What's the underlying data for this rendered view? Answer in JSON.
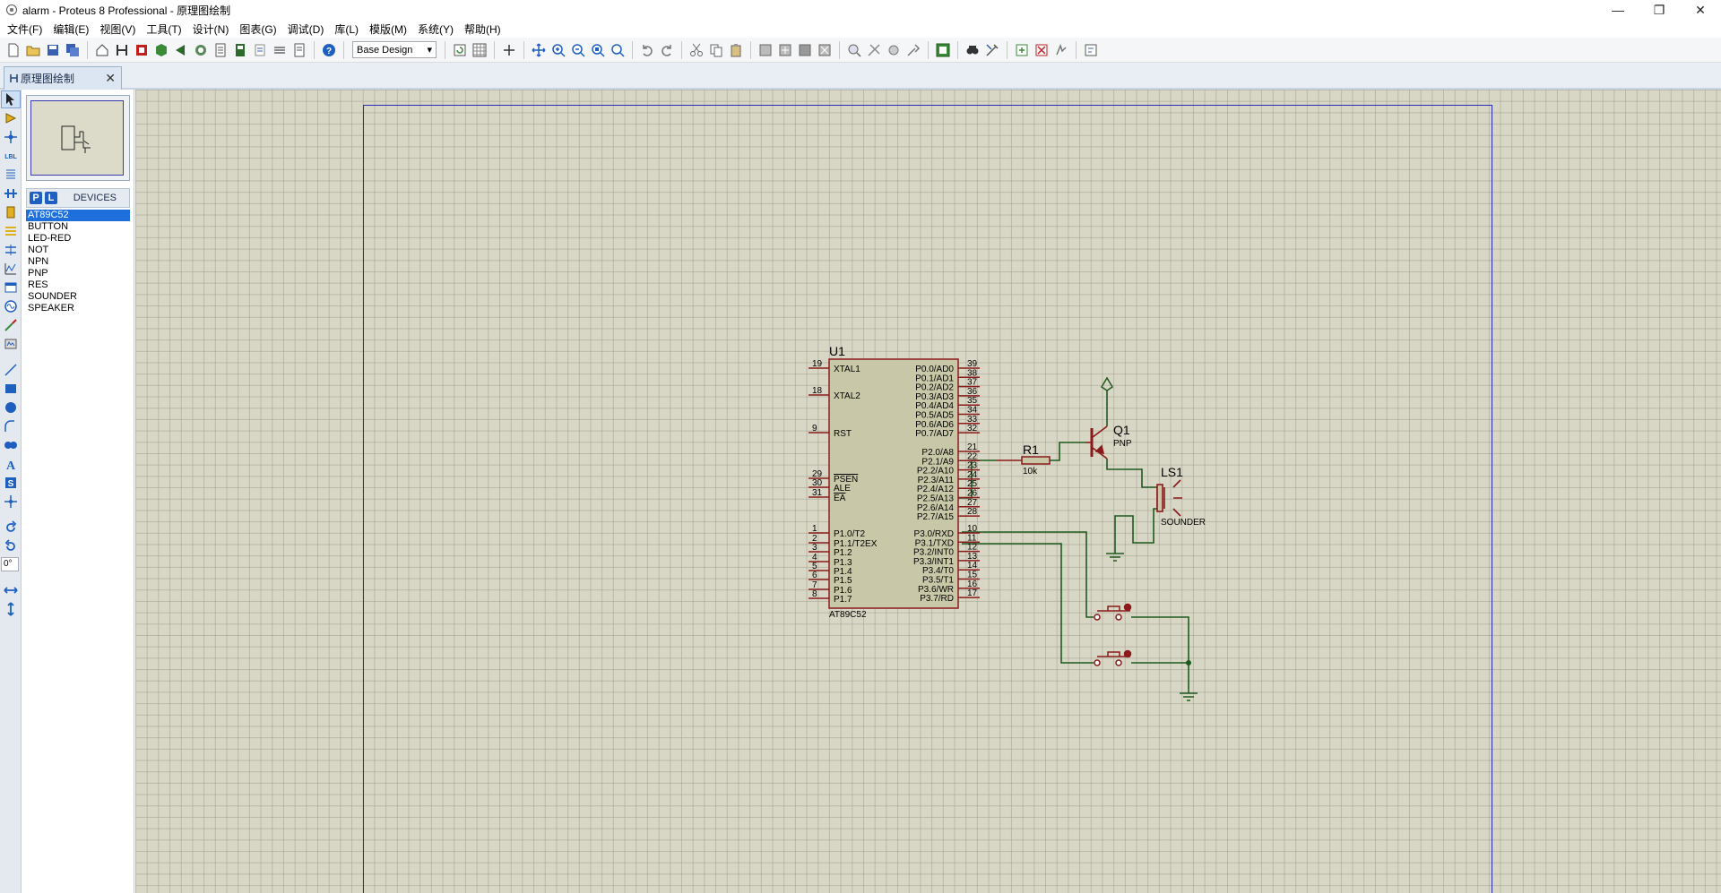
{
  "window": {
    "title": "alarm - Proteus 8 Professional - 原理图绘制",
    "minimize": "—",
    "maximize": "❐",
    "close": "✕"
  },
  "menu": [
    "文件(F)",
    "编辑(E)",
    "视图(V)",
    "工具(T)",
    "设计(N)",
    "图表(G)",
    "调试(D)",
    "库(L)",
    "模版(M)",
    "系统(Y)",
    "帮助(H)"
  ],
  "toolbar": {
    "design_select": "Base Design"
  },
  "tab": {
    "label": "原理图绘制",
    "close": "✕"
  },
  "toolcol": {
    "rotation": "0°"
  },
  "devices": {
    "p_label": "P",
    "l_label": "L",
    "title": "DEVICES",
    "items": [
      "AT89C52",
      "BUTTON",
      "LED-RED",
      "NOT",
      "NPN",
      "PNP",
      "RES",
      "SOUNDER",
      "SPEAKER"
    ],
    "selected": "AT89C52"
  },
  "schematic": {
    "u1": {
      "ref": "U1",
      "part": "AT89C52",
      "left_pins": [
        {
          "num": "19",
          "name": "XTAL1"
        },
        {
          "num": "18",
          "name": "XTAL2"
        },
        {
          "num": "9",
          "name": "RST"
        },
        {
          "num": "29",
          "name": "PSEN"
        },
        {
          "num": "30",
          "name": "ALE"
        },
        {
          "num": "31",
          "name": "EA"
        },
        {
          "num": "1",
          "name": "P1.0/T2"
        },
        {
          "num": "2",
          "name": "P1.1/T2EX"
        },
        {
          "num": "3",
          "name": "P1.2"
        },
        {
          "num": "4",
          "name": "P1.3"
        },
        {
          "num": "5",
          "name": "P1.4"
        },
        {
          "num": "6",
          "name": "P1.5"
        },
        {
          "num": "7",
          "name": "P1.6"
        },
        {
          "num": "8",
          "name": "P1.7"
        }
      ],
      "right_pins": [
        {
          "num": "39",
          "name": "P0.0/AD0"
        },
        {
          "num": "38",
          "name": "P0.1/AD1"
        },
        {
          "num": "37",
          "name": "P0.2/AD2"
        },
        {
          "num": "36",
          "name": "P0.3/AD3"
        },
        {
          "num": "35",
          "name": "P0.4/AD4"
        },
        {
          "num": "34",
          "name": "P0.5/AD5"
        },
        {
          "num": "33",
          "name": "P0.6/AD6"
        },
        {
          "num": "32",
          "name": "P0.7/AD7"
        },
        {
          "num": "21",
          "name": "P2.0/A8"
        },
        {
          "num": "22",
          "name": "P2.1/A9"
        },
        {
          "num": "23",
          "name": "P2.2/A10"
        },
        {
          "num": "24",
          "name": "P2.3/A11"
        },
        {
          "num": "25",
          "name": "P2.4/A12"
        },
        {
          "num": "26",
          "name": "P2.5/A13"
        },
        {
          "num": "27",
          "name": "P2.6/A14"
        },
        {
          "num": "28",
          "name": "P2.7/A15"
        },
        {
          "num": "10",
          "name": "P3.0/RXD"
        },
        {
          "num": "11",
          "name": "P3.1/TXD"
        },
        {
          "num": "12",
          "name": "P3.2/INT0"
        },
        {
          "num": "13",
          "name": "P3.3/INT1"
        },
        {
          "num": "14",
          "name": "P3.4/T0"
        },
        {
          "num": "15",
          "name": "P3.5/T1"
        },
        {
          "num": "16",
          "name": "P3.6/WR"
        },
        {
          "num": "17",
          "name": "P3.7/RD"
        }
      ]
    },
    "r1": {
      "ref": "R1",
      "value": "10k"
    },
    "q1": {
      "ref": "Q1",
      "type": "PNP"
    },
    "ls1": {
      "ref": "LS1",
      "type": "SOUNDER"
    }
  },
  "colors": {
    "wire": "#1e5a1e",
    "component": "#8b1a1a",
    "body": "#c8c8a8",
    "sheet": "#2a2ab8"
  }
}
